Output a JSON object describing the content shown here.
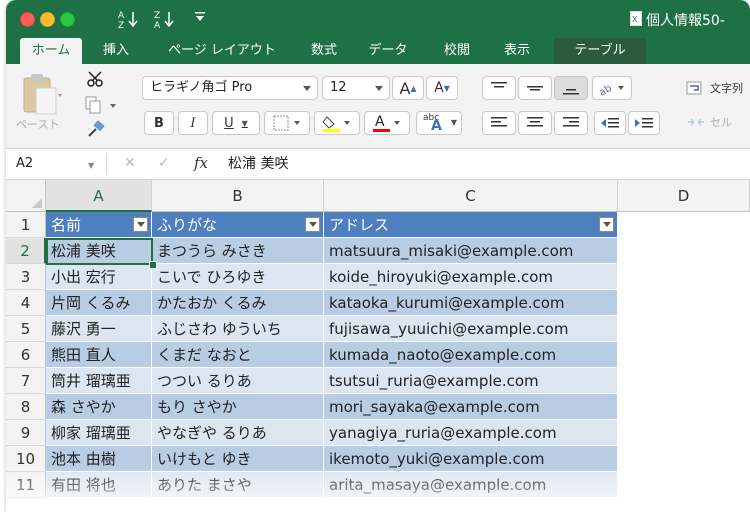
{
  "window": {
    "title": "個人情報50-",
    "quick_access": [
      "sort-ascending-icon",
      "sort-descending-icon",
      "customize-dropdown-icon"
    ]
  },
  "tabs": [
    {
      "label": "ホーム",
      "active": true
    },
    {
      "label": "挿入",
      "active": false
    },
    {
      "label": "ページ レイアウト",
      "active": false
    },
    {
      "label": "数式",
      "active": false
    },
    {
      "label": "データ",
      "active": false
    },
    {
      "label": "校閲",
      "active": false
    },
    {
      "label": "表示",
      "active": false
    },
    {
      "label": "テーブル",
      "active": false
    }
  ],
  "ribbon": {
    "paste_label": "ペースト",
    "font_name": "ヒラギノ角ゴ Pro",
    "font_size": "12",
    "bold": "B",
    "italic": "I",
    "underline": "U",
    "grow_font": "A",
    "shrink_font": "A",
    "text_label": "abc",
    "wrap_text_label": "文字列",
    "merge_label": "セル",
    "font_color": "#ff0000",
    "highlight_color": "#ffff00"
  },
  "formula_bar": {
    "name_box": "A2",
    "fx": "fx",
    "value": "松浦 美咲"
  },
  "sheet": {
    "columns": [
      "A",
      "B",
      "C",
      "D"
    ],
    "selected_column": "A",
    "selected_row": "2",
    "header": [
      "名前",
      "ふりがな",
      "アドレス"
    ],
    "rows": [
      {
        "num": "2",
        "name": "松浦 美咲",
        "kana": "まつうら みさき",
        "email": "matsuura_misaki@example.com"
      },
      {
        "num": "3",
        "name": "小出 宏行",
        "kana": "こいで ひろゆき",
        "email": "koide_hiroyuki@example.com"
      },
      {
        "num": "4",
        "name": "片岡 くるみ",
        "kana": "かたおか くるみ",
        "email": "kataoka_kurumi@example.com"
      },
      {
        "num": "5",
        "name": "藤沢 勇一",
        "kana": "ふじさわ ゆういち",
        "email": "fujisawa_yuuichi@example.com"
      },
      {
        "num": "6",
        "name": "熊田 直人",
        "kana": "くまだ なおと",
        "email": "kumada_naoto@example.com"
      },
      {
        "num": "7",
        "name": "筒井 瑠璃亜",
        "kana": "つつい るりあ",
        "email": "tsutsui_ruria@example.com"
      },
      {
        "num": "8",
        "name": "森 さやか",
        "kana": "もり さやか",
        "email": "mori_sayaka@example.com"
      },
      {
        "num": "9",
        "name": "柳家 瑠璃亜",
        "kana": "やなぎや るりあ",
        "email": "yanagiya_ruria@example.com"
      },
      {
        "num": "10",
        "name": "池本 由樹",
        "kana": "いけもと ゆき",
        "email": "ikemoto_yuki@example.com"
      },
      {
        "num": "11",
        "name": "有田 将也",
        "kana": "ありた まさや",
        "email": "arita_masaya@example.com"
      }
    ],
    "header_row_num": "1",
    "colors": {
      "header": "#4e7fbf",
      "band_dark": "#b8cce4",
      "band_light": "#dce6f1",
      "accent": "#1e7145"
    }
  }
}
